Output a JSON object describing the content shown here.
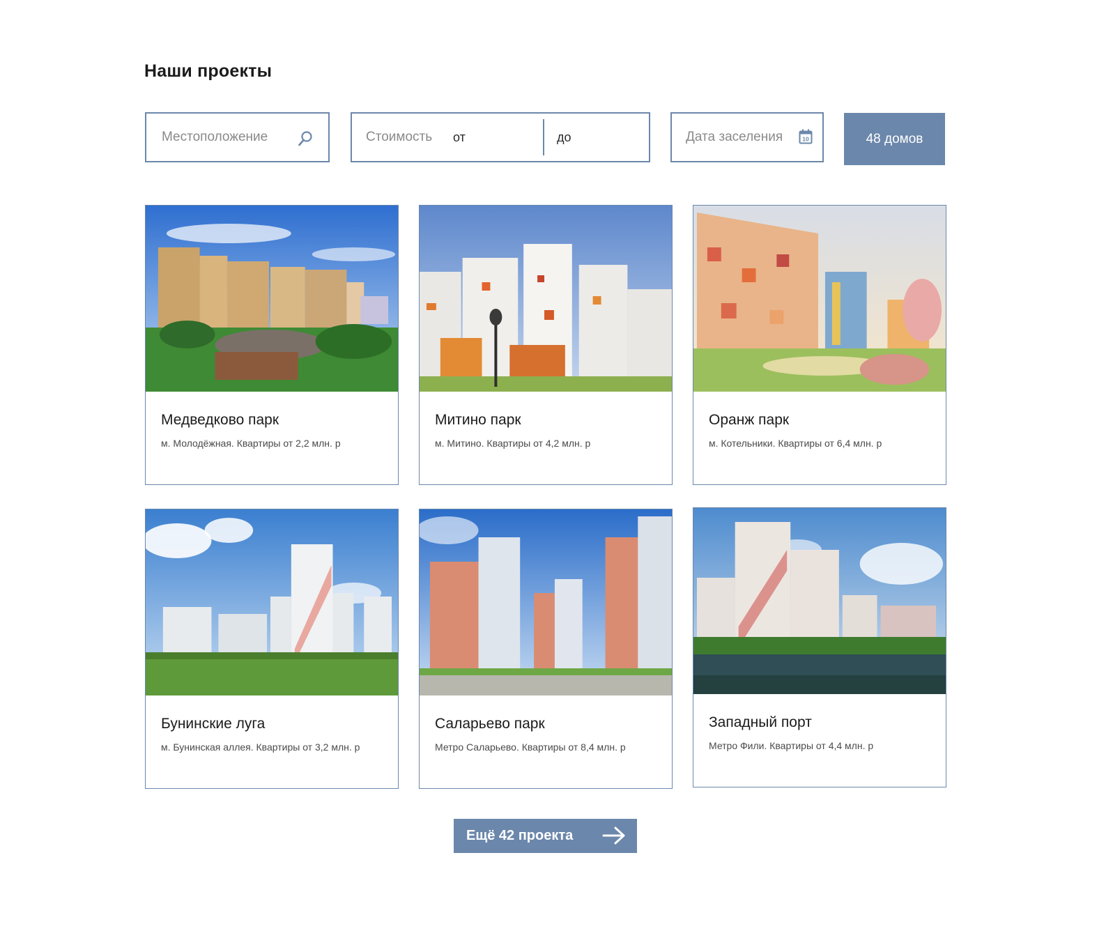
{
  "section": {
    "title": "Наши проекты"
  },
  "filters": {
    "location_placeholder": "Местоположение",
    "price_label": "Стоимость",
    "price_from": "от",
    "price_to": "до",
    "date_placeholder": "Дата заселения",
    "calendar_day": "10",
    "result_button": "48 домов"
  },
  "projects": [
    {
      "name": "Медведково парк",
      "desc": "м. Молодёжная. Квартиры от 2,2 млн. р"
    },
    {
      "name": "Митино парк",
      "desc": "м. Митино. Квартиры от 4,2 млн. р"
    },
    {
      "name": "Оранж парк",
      "desc": "м. Котельники. Квартиры от 6,4 млн. р"
    },
    {
      "name": "Бунинские луга",
      "desc": "м. Бунинская аллея. Квартиры от 3,2 млн. р"
    },
    {
      "name": "Саларьево парк",
      "desc": "Метро Саларьево. Квартиры от 8,4 млн. р"
    },
    {
      "name": "Западный порт",
      "desc": "Метро Фили. Квартиры от 4,4 млн. р"
    }
  ],
  "more_button": {
    "label": "Ещё 42 проекта"
  },
  "colors": {
    "accent": "#6b87ab",
    "text": "#1b1b1b",
    "muted": "#8a8a8a"
  }
}
